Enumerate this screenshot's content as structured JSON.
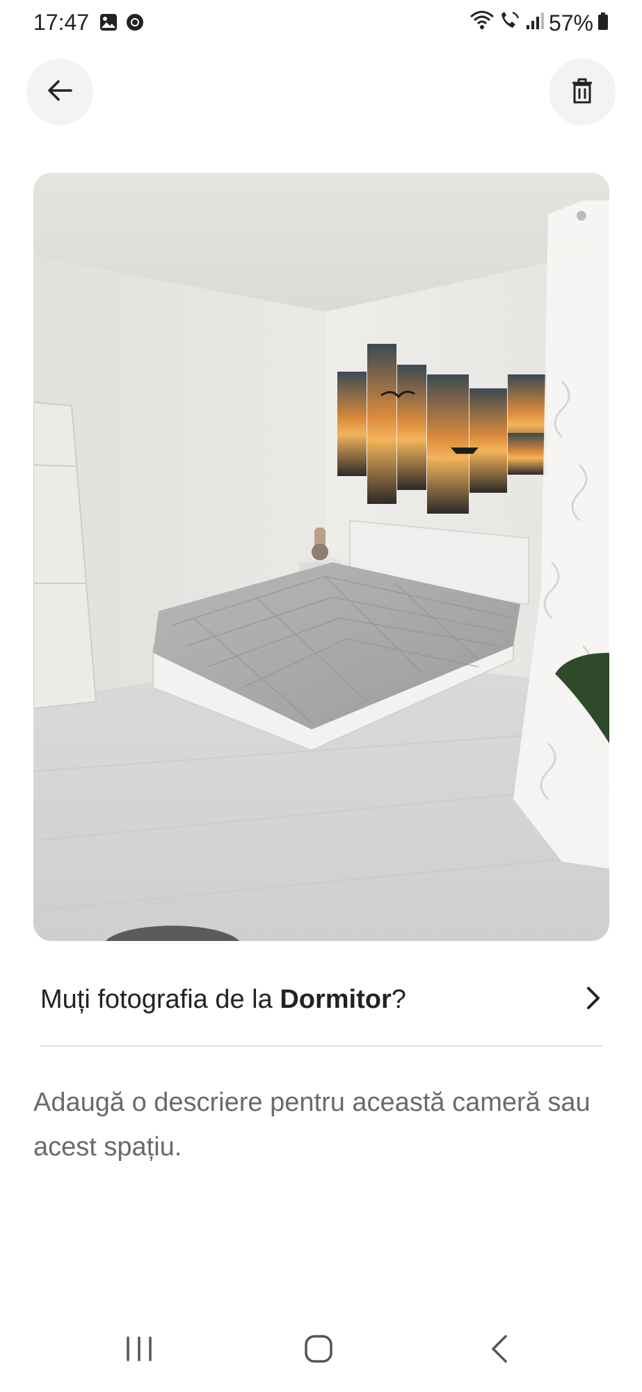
{
  "status_bar": {
    "time": "17:47",
    "left_icons": [
      "gallery-icon",
      "chrome-icon"
    ],
    "right_icons": [
      "wifi-icon",
      "wifi-call-icon",
      "signal-icon"
    ],
    "battery_percent": "57%"
  },
  "header": {
    "back_icon": "arrow-left-icon",
    "delete_icon": "trash-icon"
  },
  "move_photo": {
    "prefix": "Muți fotografia de la ",
    "room": "Dormitor",
    "suffix": "?"
  },
  "description": {
    "placeholder": "Adaugă o descriere pentru această cameră sau acest spațiu."
  },
  "nav_bar": {
    "buttons": [
      "recents-icon",
      "home-icon",
      "back-icon"
    ]
  },
  "colors": {
    "text_primary": "#222222",
    "text_secondary": "#6a6a6a",
    "button_bg": "#f3f3f3",
    "divider": "#dddddd"
  }
}
